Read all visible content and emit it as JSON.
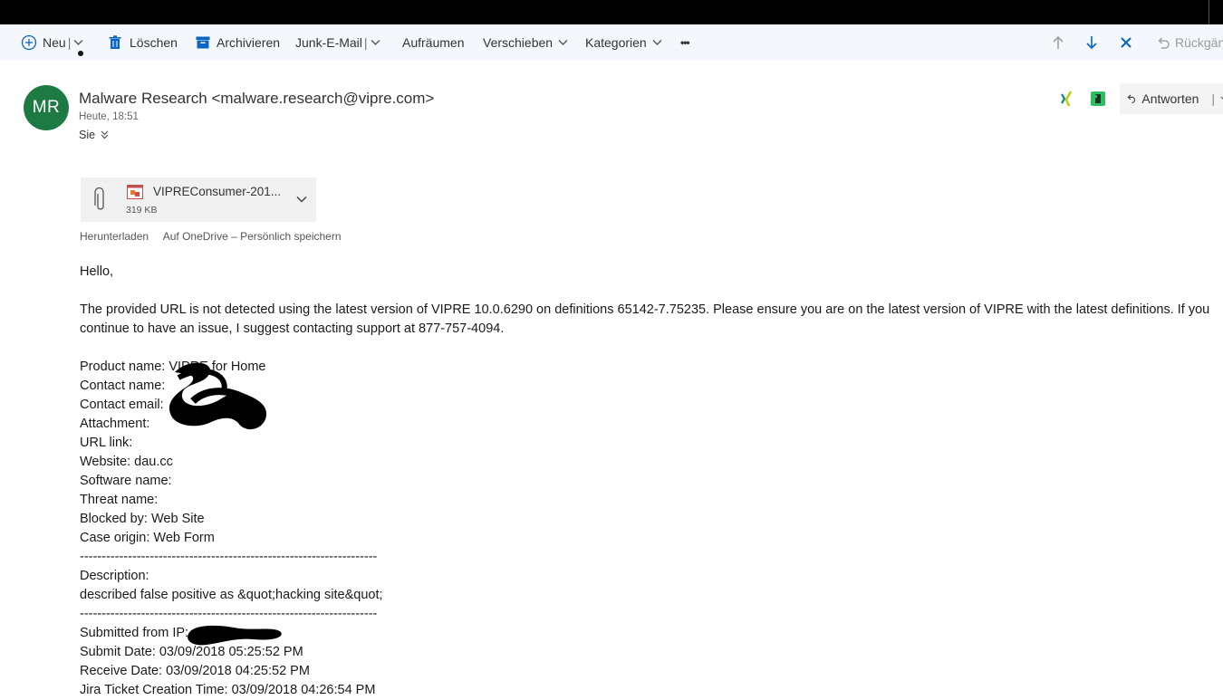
{
  "toolbar": {
    "new_label": "Neu",
    "delete_label": "Löschen",
    "archive_label": "Archivieren",
    "junk_label": "Junk-E-Mail",
    "sweep_label": "Aufräumen",
    "move_label": "Verschieben",
    "categories_label": "Kategorien",
    "more_label": "•••",
    "undo_label": "Rückgän"
  },
  "message": {
    "avatar_initials": "MR",
    "avatar_color": "#1e7a43",
    "sender": "Malware Research <malware.research@vipre.com>",
    "datetime": "Heute, 18:51",
    "to": "Sie",
    "reply_label": "Antworten"
  },
  "attachment": {
    "name": "VIPREConsumer-201...",
    "size": "319 KB",
    "download_label": "Herunterladen",
    "onedrive_label": "Auf OneDrive – Persönlich speichern"
  },
  "body": {
    "greeting": "Hello,",
    "paragraph": "The provided URL is not detected using the latest version of VIPRE 10.0.6290 on definitions 65142-7.75235. Please ensure you are on the latest version of VIPRE with the latest definitions. If you continue to have an issue, I suggest contacting support at 877-757-4094.",
    "product": "Product name: VIPRE for Home",
    "contact_name": "Contact name:",
    "contact_email": "Contact email:",
    "attachment": "Attachment:",
    "url_link": "URL link:",
    "website": "Website: dau.cc",
    "software": "Software name:",
    "threat": "Threat name:",
    "blocked": "Blocked by: Web Site",
    "case_origin": "Case origin: Web Form",
    "divider": "--------------------------------------------------------------------",
    "description_label": "Description:",
    "description": "described false positive as &quot;hacking site&quot;",
    "submitted_ip": "Submitted from IP:",
    "submit_date": "Submit Date: 03/09/2018 05:25:52 PM",
    "receive_date": "Receive Date: 03/09/2018 04:25:52 PM",
    "ticket_time": "Jira Ticket Creation Time: 03/09/2018 04:26:54 PM"
  }
}
